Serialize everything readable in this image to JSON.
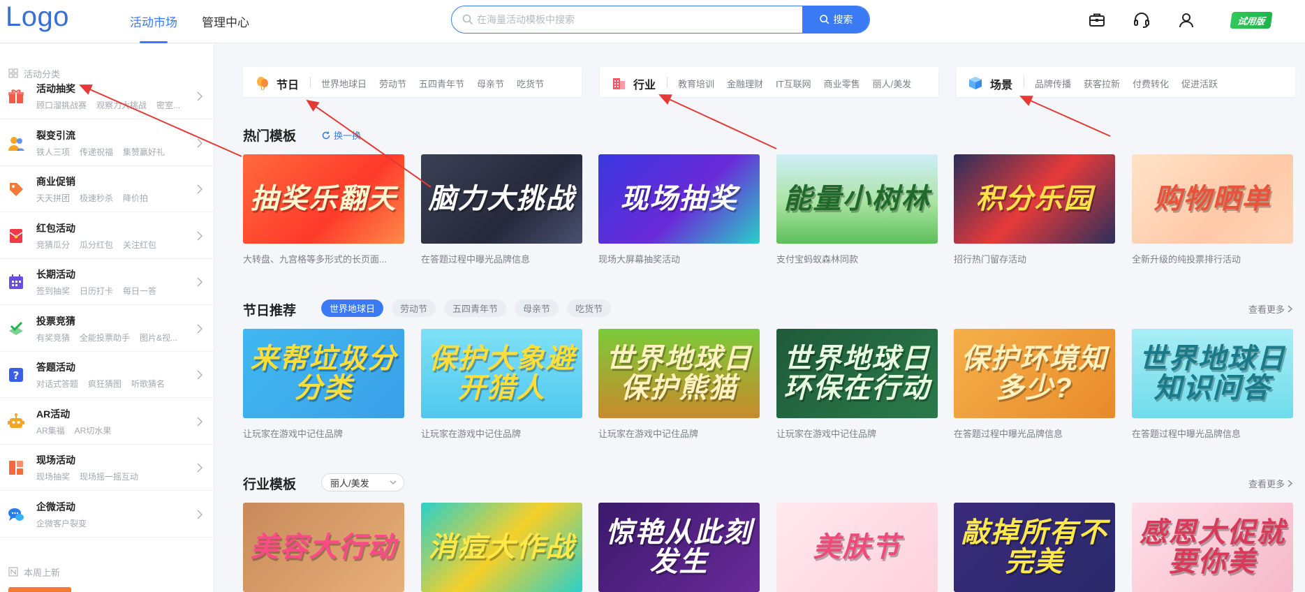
{
  "header": {
    "logo": "Logo",
    "nav": [
      {
        "label": "活动市场",
        "active": true
      },
      {
        "label": "管理中心",
        "active": false
      }
    ],
    "search": {
      "placeholder": "在海量活动模板中搜索",
      "button_label": "搜索"
    },
    "icons": [
      "briefcase-icon",
      "headset-icon",
      "user-icon"
    ],
    "trial_badge": "试用版"
  },
  "sidebar": {
    "heading": "活动分类",
    "items": [
      {
        "title": "活动抽奖",
        "subs": [
          "顾口溜挑战赛",
          "观察力大挑战",
          "密室..."
        ],
        "icon": "gift-icon",
        "color": "#f25a4a"
      },
      {
        "title": "裂变引流",
        "subs": [
          "铁人三项",
          "传递祝福",
          "集赞赢好礼"
        ],
        "icon": "people-icon",
        "color": "#f5a524"
      },
      {
        "title": "商业促销",
        "subs": [
          "天天拼团",
          "极速秒杀",
          "降价拍"
        ],
        "icon": "tag-icon",
        "color": "#f57a3a"
      },
      {
        "title": "红包活动",
        "subs": [
          "竞猜瓜分",
          "瓜分红包",
          "关注红包"
        ],
        "icon": "red-envelope-icon",
        "color": "#f03a4a"
      },
      {
        "title": "长期活动",
        "subs": [
          "签到抽奖",
          "日历打卡",
          "每日一答"
        ],
        "icon": "calendar-icon",
        "color": "#6a4ee0"
      },
      {
        "title": "投票竞猜",
        "subs": [
          "有奖竞猜",
          "全能投票助手",
          "图片&视..."
        ],
        "icon": "vote-check-icon",
        "color": "#22b34a"
      },
      {
        "title": "答题活动",
        "subs": [
          "对话式答题",
          "疯狂猜图",
          "听歌猜名"
        ],
        "icon": "question-icon",
        "color": "#3a5ee8"
      },
      {
        "title": "AR活动",
        "subs": [
          "AR集福",
          "AR切水果"
        ],
        "icon": "robot-icon",
        "color": "#f5a524"
      },
      {
        "title": "现场活动",
        "subs": [
          "现场抽奖",
          "现场摇一摇互动"
        ],
        "icon": "scene-grid-icon",
        "color": "#f56a3a"
      },
      {
        "title": "企微活动",
        "subs": [
          "企微客户裂变"
        ],
        "icon": "chat-bubble-icon",
        "color": "#2a7af0"
      }
    ],
    "footer_heading": "本周上新"
  },
  "categories": [
    {
      "title": "节日",
      "icon": "balloon-icon",
      "links": [
        "世界地球日",
        "劳动节",
        "五四青年节",
        "母亲节",
        "吃货节"
      ]
    },
    {
      "title": "行业",
      "icon": "building-icon",
      "links": [
        "教育培训",
        "金融理财",
        "IT互联网",
        "商业零售",
        "丽人/美发"
      ]
    },
    {
      "title": "场景",
      "icon": "cube-icon",
      "links": [
        "品牌传播",
        "获客拉新",
        "付费转化",
        "促进活跃"
      ]
    }
  ],
  "hot": {
    "title": "热门模板",
    "refresh_label": "换一换",
    "templates": [
      {
        "thumb_text": "抽奖乐翻天",
        "desc": "大转盘、九宫格等多形式的长页面...",
        "bg": "linear-gradient(135deg,#ff6a3d,#ff3a2a 60%,#ff8a4a)",
        "color": "#fff7d0"
      },
      {
        "thumb_text": "脑力大挑战",
        "desc": "在答题过程中曝光品牌信息",
        "bg": "linear-gradient(135deg,#3a4055,#25293a 60%,#4a5070)",
        "color": "#ffffff"
      },
      {
        "thumb_text": "现场抽奖",
        "desc": "现场大屏幕抽奖活动",
        "bg": "linear-gradient(135deg,#3a38e0,#6a2ad8 55%,#2ad0c8)",
        "color": "#ffffff"
      },
      {
        "thumb_text": "能量小树林",
        "desc": "支付宝蚂蚁森林同款",
        "bg": "linear-gradient(180deg,#cfeefa,#a9e3a0 55%,#5cbf5a)",
        "color": "#1f6a2a"
      },
      {
        "thumb_text": "积分乐园",
        "desc": "招行热门留存活动",
        "bg": "linear-gradient(135deg,#2a2f5a,#e83a3a 50%,#2a2f5a)",
        "color": "#ffe14a"
      },
      {
        "thumb_text": "购物晒单",
        "desc": "全新升级的纯投票排行活动",
        "bg": "linear-gradient(135deg,#ffe3c8,#ffc9a8 60%,#ffd6b8)",
        "color": "#e8533a"
      }
    ]
  },
  "festival": {
    "title": "节日推荐",
    "pills": [
      {
        "label": "世界地球日",
        "active": true
      },
      {
        "label": "劳动节",
        "active": false
      },
      {
        "label": "五四青年节",
        "active": false
      },
      {
        "label": "母亲节",
        "active": false
      },
      {
        "label": "吃货节",
        "active": false
      }
    ],
    "more_label": "查看更多",
    "templates": [
      {
        "thumb_text": "来帮垃圾分分类",
        "desc": "让玩家在游戏中记住品牌",
        "bg": "linear-gradient(135deg,#40b8f0,#3aa0e8)",
        "color": "#ffdd3a"
      },
      {
        "thumb_text": "保护大象避开猎人",
        "desc": "让玩家在游戏中记住品牌",
        "bg": "linear-gradient(180deg,#7fe0f5,#4fc8f0)",
        "color": "#ffdd3a"
      },
      {
        "thumb_text": "世界地球日保护熊猫",
        "desc": "让玩家在游戏中记住品牌",
        "bg": "linear-gradient(180deg,#7acb3a,#c88a2a)",
        "color": "#fff2c0"
      },
      {
        "thumb_text": "世界地球日环保在行动",
        "desc": "让玩家在游戏中记住品牌",
        "bg": "linear-gradient(135deg,#1f5a3a,#2a7a4a)",
        "color": "#e8ffe0"
      },
      {
        "thumb_text": "保护环境知多少?",
        "desc": "在答题过程中曝光品牌信息",
        "bg": "linear-gradient(135deg,#f5b04a,#e88a2a)",
        "color": "#fff2c0"
      },
      {
        "thumb_text": "世界地球日知识问答",
        "desc": "在答题过程中曝光品牌信息",
        "bg": "linear-gradient(180deg,#a8eef5,#6fdcea)",
        "color": "#1a7a8a"
      }
    ]
  },
  "industry": {
    "title": "行业模板",
    "select_value": "丽人/美发",
    "more_label": "查看更多",
    "templates": [
      {
        "thumb_text": "美容大行动",
        "desc": "",
        "bg": "linear-gradient(135deg,#c88a5a,#e8b07a)",
        "color": "#ff4a8a"
      },
      {
        "thumb_text": "消痘大作战",
        "desc": "",
        "bg": "linear-gradient(135deg,#2ad0c8,#f5d02a 50%,#2ad0c8)",
        "color": "#ffe84a"
      },
      {
        "thumb_text": "惊艳从此刻发生",
        "desc": "",
        "bg": "linear-gradient(135deg,#3a1a6a,#6a2a9a)",
        "color": "#ffffff"
      },
      {
        "thumb_text": "美肤节",
        "desc": "",
        "bg": "linear-gradient(135deg,#ffe8ee,#ffd2dc)",
        "color": "#f04a7a"
      },
      {
        "thumb_text": "敲掉所有不完美",
        "desc": "",
        "bg": "linear-gradient(135deg,#3a2a7a,#2a2a6a)",
        "color": "#ffe84a"
      },
      {
        "thumb_text": "感恩大促就要你美",
        "desc": "",
        "bg": "linear-gradient(135deg,#ffe0e8,#f5b8c8)",
        "color": "#d83a5a"
      }
    ]
  }
}
